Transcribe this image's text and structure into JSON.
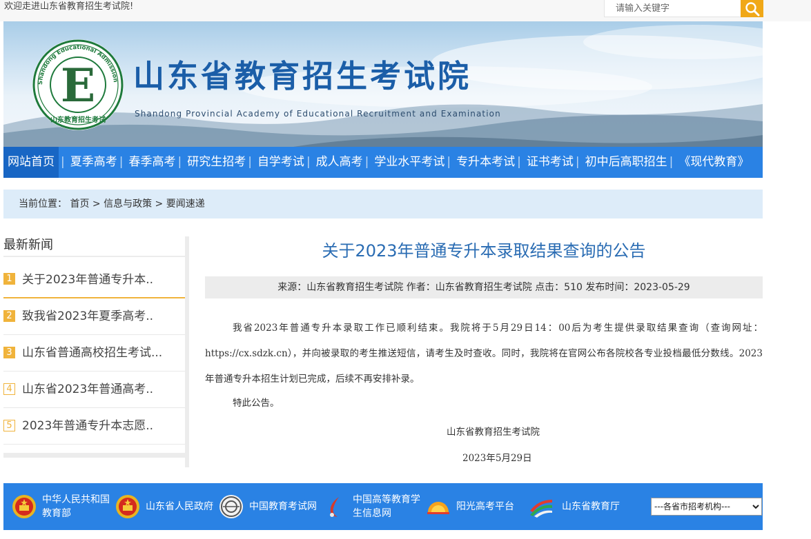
{
  "topbar": {
    "welcome": "欢迎走进山东省教育招生考试院!",
    "search_placeholder": "请输入关键字",
    "search_icon": "search-icon"
  },
  "banner": {
    "title": "山东省教育招生考试院",
    "subtitle": "Shandong Provincial Academy of Educational Recruitment and Examination",
    "seal_text": "Shandong Educational Admission & Examinations",
    "seal_cn": "山东教育招生考试",
    "seal_letter": "E"
  },
  "nav": {
    "items": [
      {
        "label": "网站首页",
        "active": true
      },
      {
        "label": "夏季高考"
      },
      {
        "label": "春季高考"
      },
      {
        "label": "研究生招考"
      },
      {
        "label": "自学考试"
      },
      {
        "label": "成人高考"
      },
      {
        "label": "学业水平考试"
      },
      {
        "label": "专升本考试"
      },
      {
        "label": "证书考试"
      },
      {
        "label": "初中后高职招生"
      },
      {
        "label": "《现代教育》"
      }
    ]
  },
  "breadcrumb": {
    "prefix": "当前位置：",
    "items": [
      "首页",
      "信息与政策",
      "要闻速递"
    ],
    "sep": ">"
  },
  "sidebar": {
    "title": "最新新闻",
    "items": [
      {
        "num": "1",
        "text": "关于2023年普通专升本.."
      },
      {
        "num": "2",
        "text": "致我省2023年夏季高考.."
      },
      {
        "num": "3",
        "text": "山东省普通高校招生考试..."
      },
      {
        "num": "4",
        "text": "山东省2023年普通高考.."
      },
      {
        "num": "5",
        "text": "2023年普通专升本志愿.."
      }
    ]
  },
  "article": {
    "title": "关于2023年普通专升本录取结果查询的公告",
    "meta": "来源：山东省教育招生考试院 作者：山东省教育招生考试院 点击：510 发布时间：2023-05-29",
    "body": "我省2023年普通专升本录取工作已顺利结束。我院将于5月29日14：00后为考生提供录取结果查询（查询网址：https://cx.sdzk.cn），并向被录取的考生推送短信，请考生及时查收。同时，我院将在官网公布各院校各专业投档最低分数线。2023年普通专升本招生计划已完成，后续不再安排补录。",
    "notice": "特此公告。",
    "signature": "山东省教育招生考试院",
    "date": "2023年5月29日"
  },
  "footer": {
    "links": [
      {
        "label": "中华人民共和国教育部",
        "icon": "national-emblem-icon"
      },
      {
        "label": "山东省人民政府",
        "icon": "national-emblem-icon"
      },
      {
        "label": "中国教育考试网",
        "icon": "neea-logo-icon"
      },
      {
        "label": "中国高等教育学生信息网",
        "icon": "chsi-logo-icon"
      },
      {
        "label": "阳光高考平台",
        "icon": "sunshine-logo-icon"
      },
      {
        "label": "山东省教育厅",
        "icon": "sd-edu-logo-icon"
      }
    ],
    "select_value": "---各省市招考机构---"
  },
  "colors": {
    "nav_blue": "#2a82e4",
    "nav_active": "#1866c4",
    "title_blue": "#2a6cb3",
    "accent_orange": "#f0b33b",
    "search_orange": "#f0a818",
    "crumb_bg": "#ddecf9"
  }
}
